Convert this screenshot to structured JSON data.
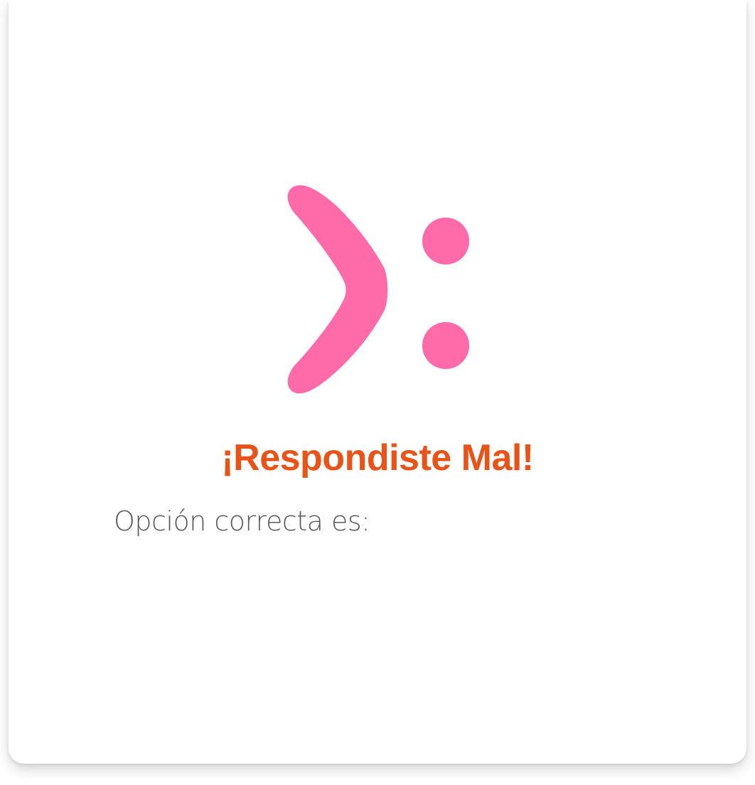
{
  "result": {
    "title": "¡Respondiste Mal!",
    "answer_label": "Opción correcta es:",
    "answer_value": ""
  },
  "icon": {
    "name": "sad-face-icon"
  },
  "colors": {
    "face": "#ff6ba8",
    "title": "#e8531a",
    "label": "#5a5a5a",
    "card": "#ffffff"
  }
}
